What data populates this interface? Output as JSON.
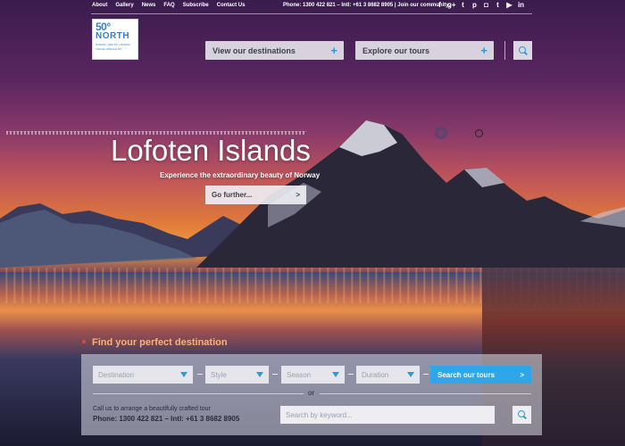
{
  "toplinks": [
    "About",
    "Gallery",
    "News",
    "FAQ",
    "Subscribe",
    "Contact Us"
  ],
  "contact": "Phone: 1300 422 821 – Intl: +61 3 8682 8905  |  Join our community:",
  "social_icons": [
    "facebook-icon",
    "google-plus-icon",
    "twitter-icon",
    "pinterest-icon",
    "instagram-icon",
    "tumblr-icon",
    "youtube-icon",
    "linkedin-icon"
  ],
  "social_glyphs": [
    "f",
    "g+",
    "t",
    "p",
    "◘",
    "t",
    "▶",
    "in"
  ],
  "logo": {
    "degree": "50°",
    "name": "NORTH",
    "line1": "NORDIC | ARCTIC | RUSSIA",
    "line2": "TRAVEL SPECIALIST"
  },
  "nav": {
    "destinations": "View our destinations",
    "tours": "Explore our tours",
    "plus": "+"
  },
  "hero": {
    "title": "Lofoten Islands",
    "subtitle": "Experience the extraordinary beauty of Norway",
    "cta": "Go further...",
    "cta_arrow": ">"
  },
  "finder": {
    "title": "Find your perfect destination",
    "destination": "Destination",
    "style": "Style",
    "season": "Season",
    "duration": "Duration",
    "search_label": "Search our tours",
    "search_arrow": ">",
    "or": "or",
    "call_line1": "Call us to arrange a beautifully crafted tour",
    "call_line2": "Phone: 1300 422 821 – Intl: +61 3 8682 8905",
    "keyword_placeholder": "Search by keyword..."
  },
  "colors": {
    "accent": "#2ea6e8",
    "find_title": "#ffb070"
  }
}
